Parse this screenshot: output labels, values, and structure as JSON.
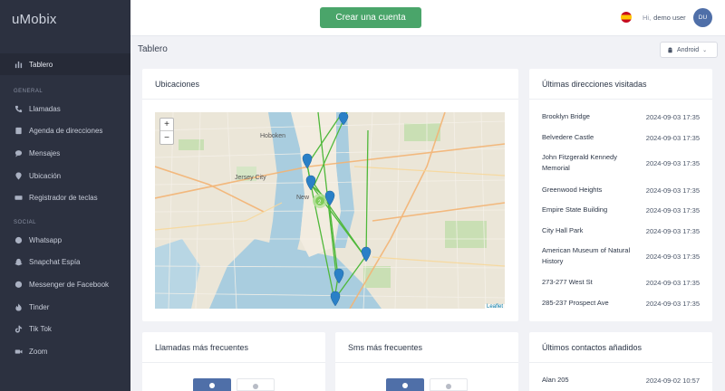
{
  "app": {
    "logo": "uMobix"
  },
  "sidebar": {
    "active": {
      "label": "Tablero",
      "icon": "dashboard-icon"
    },
    "general_label": "GENERAL",
    "general": [
      {
        "label": "Llamadas",
        "icon": "phone-icon"
      },
      {
        "label": "Agenda de direcciones",
        "icon": "address-book-icon"
      },
      {
        "label": "Mensajes",
        "icon": "chat-icon"
      },
      {
        "label": "Ubicación",
        "icon": "location-pin-icon"
      },
      {
        "label": "Registrador de teclas",
        "icon": "keyboard-icon"
      }
    ],
    "social_label": "SOCIAL",
    "social": [
      {
        "label": "Whatsapp",
        "icon": "whatsapp-icon"
      },
      {
        "label": "Snapchat Espía",
        "icon": "snapchat-icon"
      },
      {
        "label": "Messenger de Facebook",
        "icon": "messenger-icon"
      },
      {
        "label": "Tinder",
        "icon": "tinder-icon"
      },
      {
        "label": "Tik Tok",
        "icon": "tiktok-icon"
      },
      {
        "label": "Zoom",
        "icon": "zoom-icon"
      }
    ]
  },
  "topbar": {
    "cta": "Crear una cuenta",
    "hi": "Hi,",
    "user": "demo user",
    "avatar": "DU",
    "flag": "spain-flag-icon"
  },
  "page": {
    "title": "Tablero",
    "device": "Android"
  },
  "map": {
    "title": "Ubicaciones",
    "zoom_in": "+",
    "zoom_out": "−",
    "attribution": "Leaflet",
    "cluster_count": "2",
    "labels": {
      "hoboken": "Hoboken",
      "jersey_city": "Jersey City",
      "new_york": "New"
    }
  },
  "recent_addresses": {
    "title": "Últimas direcciones visitadas",
    "items": [
      {
        "name": "Brooklyn Bridge",
        "time": "2024-09-03 17:35"
      },
      {
        "name": "Belvedere Castle",
        "time": "2024-09-03 17:35"
      },
      {
        "name": "John Fitzgerald Kennedy Memorial",
        "time": "2024-09-03 17:35"
      },
      {
        "name": "Greenwood Heights",
        "time": "2024-09-03 17:35"
      },
      {
        "name": "Empire State Building",
        "time": "2024-09-03 17:35"
      },
      {
        "name": "City Hall Park",
        "time": "2024-09-03 17:35"
      },
      {
        "name": "American Museum of Natural History",
        "time": "2024-09-03 17:35"
      },
      {
        "name": "273-277 West St",
        "time": "2024-09-03 17:35"
      },
      {
        "name": "285-237 Prospect Ave",
        "time": "2024-09-03 17:35"
      }
    ]
  },
  "frequent_calls": {
    "title": "Llamadas más frecuentes"
  },
  "frequent_sms": {
    "title": "Sms más frecuentes"
  },
  "recent_contacts": {
    "title": "Últimos contactos añadidos",
    "items": [
      {
        "name": "Alan 205",
        "time": "2024-09-02 10:57"
      }
    ]
  }
}
